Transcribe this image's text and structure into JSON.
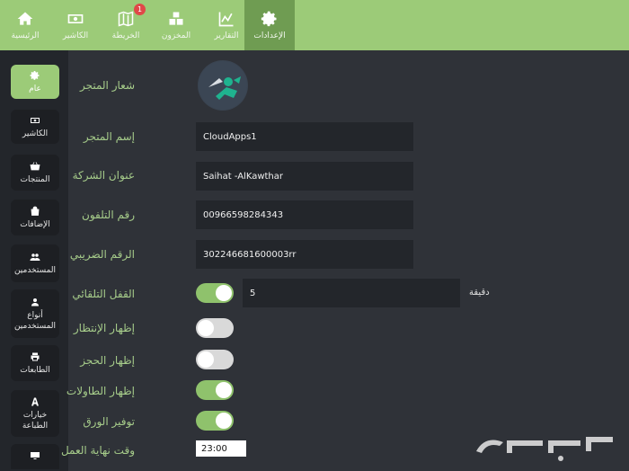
{
  "topnav": {
    "items": [
      {
        "label": "الرئيسية",
        "icon": "home-icon"
      },
      {
        "label": "الكاشير",
        "icon": "cash-icon"
      },
      {
        "label": "الخريطة",
        "icon": "map-icon",
        "badge": "1"
      },
      {
        "label": "المخزون",
        "icon": "boxes-icon"
      },
      {
        "label": "التقارير",
        "icon": "chart-icon"
      },
      {
        "label": "الإعدادات",
        "icon": "gear-icon",
        "active": true
      }
    ]
  },
  "sidebar": {
    "items": [
      {
        "label": "عام",
        "icon": "gear-icon",
        "active": true
      },
      {
        "label": "الكاشير",
        "icon": "cash-icon"
      },
      {
        "label": "المنتجات",
        "icon": "basket-icon"
      },
      {
        "label": "الإضافات",
        "icon": "bag-icon"
      },
      {
        "label": "المستخدمين",
        "icon": "users-icon"
      },
      {
        "label": "أنواع المستخدمين",
        "icon": "user-icon"
      },
      {
        "label": "الطابعات",
        "icon": "printer-icon"
      },
      {
        "label": "خيارات الطباعة",
        "icon": "font-icon"
      },
      {
        "label": "",
        "icon": "monitor-icon"
      }
    ]
  },
  "form": {
    "store_logo_label": "شعار المتجر",
    "store_name_label": "إسم المتجر",
    "store_name_value": "CloudApps1",
    "company_address_label": "عنوان الشركة",
    "company_address_value": "Saihat -AlKawthar",
    "phone_label": "رقم التلفون",
    "phone_value": "00966598284343",
    "tax_number_label": "الرقم الضريبي",
    "tax_number_value": "302246681600003rr",
    "auto_lock_label": "القفل التلقائي",
    "auto_lock_on": true,
    "auto_lock_minutes": "5",
    "minutes_unit": "دقيقة",
    "show_waiting_label": "إظهار الإنتظار",
    "show_waiting_on": false,
    "show_reservation_label": "إظهار الحجز",
    "show_reservation_on": false,
    "show_tables_label": "إظهار الطاولات",
    "show_tables_on": true,
    "save_paper_label": "توفير الورق",
    "save_paper_on": true,
    "end_of_work_label": "وقت نهاية العمل",
    "end_of_work_value": "23:00"
  },
  "watermark": {
    "icon": "haraj-logo",
    "text": "حراج"
  },
  "colors": {
    "accent": "#9ccb78",
    "background": "#2f3238",
    "sidebar": "#23262b",
    "label": "#a6cc8a"
  }
}
